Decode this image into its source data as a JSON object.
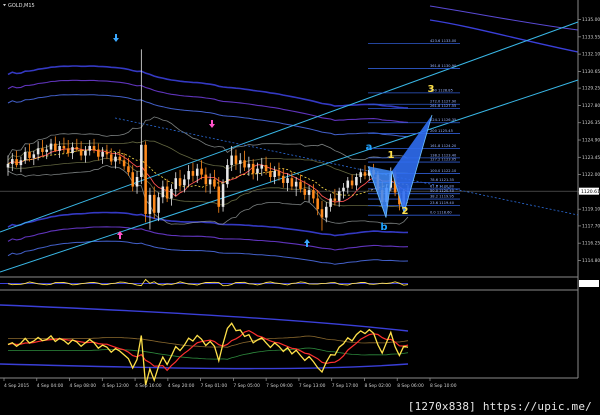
{
  "chart_data": {
    "type": "candlestick",
    "title": "GOLD,M15",
    "xlabel": "",
    "ylabel": "",
    "ylim": [
      1113.5,
      1135.8
    ],
    "grid": false,
    "legend": "none",
    "x_ticks": [
      "4 Sep 2015",
      "4 Sep 04:00",
      "4 Sep 08:00",
      "4 Sep 12:00",
      "4 Sep 16:00",
      "4 Sep 20:00",
      "7 Sep 01:00",
      "7 Sep 05:00",
      "7 Sep 09:00",
      "7 Sep 13:00",
      "7 Sep 17:00",
      "8 Sep 02:00",
      "8 Sep 06:00",
      "8 Sep 10:00"
    ],
    "y_ticks": [
      1135.0,
      1133.55,
      1132.1,
      1130.65,
      1129.25,
      1127.8,
      1126.35,
      1124.9,
      1123.45,
      1122.0,
      1120.55,
      1119.1,
      1117.7,
      1116.25,
      1114.8
    ],
    "current_price_label": "1120.61",
    "fib_levels": [
      {
        "label": "423.6 1133.00",
        "price": 1133.0
      },
      {
        "label": "361.8 1130.90",
        "price": 1130.9
      },
      {
        "label": "300 1128.85",
        "price": 1128.85
      },
      {
        "label": "272.0 1127.90",
        "price": 1127.9
      },
      {
        "label": "261.8 1127.55",
        "price": 1127.55
      },
      {
        "label": "224.1 1126.35",
        "price": 1126.35
      },
      {
        "label": "200 1125.45",
        "price": 1125.45
      },
      {
        "label": "161.8 1124.20",
        "price": 1124.2
      },
      {
        "label": "138.2 1123.40",
        "price": 1123.4
      },
      {
        "label": "127.2 1123.05",
        "price": 1123.05
      },
      {
        "label": "100.0 1122.10",
        "price": 1122.1
      },
      {
        "label": "78.6 1121.35",
        "price": 1121.35
      },
      {
        "label": "61.8 1120.80",
        "price": 1120.8
      },
      {
        "label": "50.0 1120.40",
        "price": 1120.4
      },
      {
        "label": "38.2 1119.95",
        "price": 1119.95
      },
      {
        "label": "23.6 1119.40",
        "price": 1119.4
      },
      {
        "label": "0.0 1118.60",
        "price": 1118.6
      }
    ],
    "wave_labels": [
      {
        "text": "a",
        "color": "#1fa3ff"
      },
      {
        "text": "b",
        "color": "#1fa3ff"
      },
      {
        "text": "1",
        "color": "#ffe14a"
      },
      {
        "text": "2",
        "color": "#ffe14a"
      },
      {
        "text": "3",
        "color": "#ffe14a"
      }
    ],
    "candles": [
      {
        "o": 1122.6,
        "h": 1123.6,
        "l": 1121.9,
        "c": 1122.9
      },
      {
        "o": 1122.9,
        "h": 1123.8,
        "l": 1122.3,
        "c": 1123.3
      },
      {
        "o": 1123.3,
        "h": 1124.0,
        "l": 1122.6,
        "c": 1122.8
      },
      {
        "o": 1122.8,
        "h": 1123.5,
        "l": 1122.2,
        "c": 1123.2
      },
      {
        "o": 1123.2,
        "h": 1124.3,
        "l": 1122.9,
        "c": 1123.9
      },
      {
        "o": 1123.9,
        "h": 1124.6,
        "l": 1123.1,
        "c": 1123.4
      },
      {
        "o": 1123.4,
        "h": 1124.0,
        "l": 1122.8,
        "c": 1123.7
      },
      {
        "o": 1123.7,
        "h": 1124.8,
        "l": 1123.2,
        "c": 1124.2
      },
      {
        "o": 1124.2,
        "h": 1124.9,
        "l": 1123.6,
        "c": 1123.9
      },
      {
        "o": 1123.9,
        "h": 1124.5,
        "l": 1123.3,
        "c": 1124.1
      },
      {
        "o": 1124.1,
        "h": 1125.0,
        "l": 1123.7,
        "c": 1124.6
      },
      {
        "o": 1124.6,
        "h": 1125.2,
        "l": 1123.9,
        "c": 1124.0
      },
      {
        "o": 1124.0,
        "h": 1124.8,
        "l": 1123.4,
        "c": 1124.4
      },
      {
        "o": 1124.4,
        "h": 1125.1,
        "l": 1123.8,
        "c": 1124.2
      },
      {
        "o": 1124.2,
        "h": 1124.9,
        "l": 1123.5,
        "c": 1123.8
      },
      {
        "o": 1123.8,
        "h": 1124.7,
        "l": 1123.3,
        "c": 1124.3
      },
      {
        "o": 1124.3,
        "h": 1125.0,
        "l": 1123.9,
        "c": 1124.1
      },
      {
        "o": 1124.1,
        "h": 1124.8,
        "l": 1123.2,
        "c": 1123.6
      },
      {
        "o": 1123.6,
        "h": 1124.4,
        "l": 1123.0,
        "c": 1124.0
      },
      {
        "o": 1124.0,
        "h": 1124.9,
        "l": 1123.6,
        "c": 1124.4
      },
      {
        "o": 1124.4,
        "h": 1125.0,
        "l": 1123.8,
        "c": 1124.1
      },
      {
        "o": 1124.1,
        "h": 1124.6,
        "l": 1123.2,
        "c": 1123.5
      },
      {
        "o": 1123.5,
        "h": 1124.3,
        "l": 1122.9,
        "c": 1123.9
      },
      {
        "o": 1123.9,
        "h": 1124.5,
        "l": 1123.3,
        "c": 1123.7
      },
      {
        "o": 1123.7,
        "h": 1124.2,
        "l": 1122.8,
        "c": 1123.1
      },
      {
        "o": 1123.1,
        "h": 1123.9,
        "l": 1122.5,
        "c": 1123.5
      },
      {
        "o": 1123.5,
        "h": 1124.1,
        "l": 1122.9,
        "c": 1123.2
      },
      {
        "o": 1123.2,
        "h": 1123.8,
        "l": 1122.4,
        "c": 1122.7
      },
      {
        "o": 1122.7,
        "h": 1123.4,
        "l": 1121.9,
        "c": 1122.2
      },
      {
        "o": 1122.2,
        "h": 1122.8,
        "l": 1120.6,
        "c": 1121.0
      },
      {
        "o": 1121.0,
        "h": 1122.3,
        "l": 1120.4,
        "c": 1121.8
      },
      {
        "o": 1121.8,
        "h": 1132.5,
        "l": 1121.2,
        "c": 1124.5
      },
      {
        "o": 1124.5,
        "h": 1124.8,
        "l": 1118.0,
        "c": 1118.7
      },
      {
        "o": 1118.7,
        "h": 1120.9,
        "l": 1117.4,
        "c": 1120.3
      },
      {
        "o": 1120.3,
        "h": 1121.0,
        "l": 1118.3,
        "c": 1118.8
      },
      {
        "o": 1118.8,
        "h": 1120.5,
        "l": 1118.1,
        "c": 1120.1
      },
      {
        "o": 1120.1,
        "h": 1121.5,
        "l": 1119.6,
        "c": 1121.0
      },
      {
        "o": 1121.0,
        "h": 1121.6,
        "l": 1119.7,
        "c": 1120.0
      },
      {
        "o": 1120.0,
        "h": 1121.2,
        "l": 1119.4,
        "c": 1120.8
      },
      {
        "o": 1120.8,
        "h": 1122.2,
        "l": 1120.2,
        "c": 1121.7
      },
      {
        "o": 1121.7,
        "h": 1122.4,
        "l": 1120.6,
        "c": 1121.1
      },
      {
        "o": 1121.1,
        "h": 1122.0,
        "l": 1120.5,
        "c": 1121.6
      },
      {
        "o": 1121.6,
        "h": 1122.8,
        "l": 1121.0,
        "c": 1122.3
      },
      {
        "o": 1122.3,
        "h": 1123.0,
        "l": 1121.4,
        "c": 1121.9
      },
      {
        "o": 1121.9,
        "h": 1122.9,
        "l": 1121.3,
        "c": 1122.5
      },
      {
        "o": 1122.5,
        "h": 1123.2,
        "l": 1121.6,
        "c": 1122.0
      },
      {
        "o": 1122.0,
        "h": 1122.6,
        "l": 1120.5,
        "c": 1121.2
      },
      {
        "o": 1121.2,
        "h": 1122.1,
        "l": 1120.4,
        "c": 1121.6
      },
      {
        "o": 1121.6,
        "h": 1122.4,
        "l": 1120.8,
        "c": 1121.0
      },
      {
        "o": 1121.0,
        "h": 1121.8,
        "l": 1118.8,
        "c": 1119.3
      },
      {
        "o": 1119.3,
        "h": 1121.6,
        "l": 1118.9,
        "c": 1121.2
      },
      {
        "o": 1121.2,
        "h": 1123.3,
        "l": 1120.9,
        "c": 1122.8
      },
      {
        "o": 1122.8,
        "h": 1124.4,
        "l": 1122.3,
        "c": 1123.6
      },
      {
        "o": 1123.6,
        "h": 1124.1,
        "l": 1122.4,
        "c": 1122.9
      },
      {
        "o": 1122.9,
        "h": 1123.8,
        "l": 1122.1,
        "c": 1123.2
      },
      {
        "o": 1123.2,
        "h": 1124.0,
        "l": 1122.3,
        "c": 1122.6
      },
      {
        "o": 1122.6,
        "h": 1123.5,
        "l": 1121.9,
        "c": 1122.9
      },
      {
        "o": 1122.9,
        "h": 1123.3,
        "l": 1121.6,
        "c": 1122.1
      },
      {
        "o": 1122.1,
        "h": 1123.0,
        "l": 1121.5,
        "c": 1122.5
      },
      {
        "o": 1122.5,
        "h": 1123.4,
        "l": 1121.9,
        "c": 1122.8
      },
      {
        "o": 1122.8,
        "h": 1123.5,
        "l": 1122.0,
        "c": 1122.3
      },
      {
        "o": 1122.3,
        "h": 1123.0,
        "l": 1121.4,
        "c": 1121.8
      },
      {
        "o": 1121.8,
        "h": 1122.7,
        "l": 1121.2,
        "c": 1122.3
      },
      {
        "o": 1122.3,
        "h": 1123.0,
        "l": 1121.5,
        "c": 1121.9
      },
      {
        "o": 1121.9,
        "h": 1122.5,
        "l": 1120.9,
        "c": 1121.3
      },
      {
        "o": 1121.3,
        "h": 1122.1,
        "l": 1120.6,
        "c": 1121.7
      },
      {
        "o": 1121.7,
        "h": 1122.2,
        "l": 1120.7,
        "c": 1121.0
      },
      {
        "o": 1121.0,
        "h": 1121.8,
        "l": 1120.2,
        "c": 1121.4
      },
      {
        "o": 1121.4,
        "h": 1122.0,
        "l": 1120.5,
        "c": 1120.8
      },
      {
        "o": 1120.8,
        "h": 1121.5,
        "l": 1119.9,
        "c": 1120.3
      },
      {
        "o": 1120.3,
        "h": 1121.1,
        "l": 1119.7,
        "c": 1120.7
      },
      {
        "o": 1120.7,
        "h": 1121.2,
        "l": 1119.6,
        "c": 1120.0
      },
      {
        "o": 1120.0,
        "h": 1120.7,
        "l": 1118.6,
        "c": 1119.1
      },
      {
        "o": 1119.1,
        "h": 1119.8,
        "l": 1117.3,
        "c": 1118.4
      },
      {
        "o": 1118.4,
        "h": 1119.7,
        "l": 1118.0,
        "c": 1119.3
      },
      {
        "o": 1119.3,
        "h": 1120.4,
        "l": 1118.9,
        "c": 1120.0
      },
      {
        "o": 1120.0,
        "h": 1120.8,
        "l": 1119.4,
        "c": 1119.8
      },
      {
        "o": 1119.8,
        "h": 1120.9,
        "l": 1119.3,
        "c": 1120.6
      },
      {
        "o": 1120.6,
        "h": 1121.3,
        "l": 1120.0,
        "c": 1120.9
      },
      {
        "o": 1120.9,
        "h": 1121.8,
        "l": 1120.4,
        "c": 1121.5
      },
      {
        "o": 1121.5,
        "h": 1122.0,
        "l": 1120.8,
        "c": 1121.1
      },
      {
        "o": 1121.1,
        "h": 1122.1,
        "l": 1120.7,
        "c": 1121.8
      },
      {
        "o": 1121.8,
        "h": 1122.5,
        "l": 1121.3,
        "c": 1122.2
      },
      {
        "o": 1122.2,
        "h": 1122.8,
        "l": 1121.6,
        "c": 1121.9
      },
      {
        "o": 1121.9,
        "h": 1122.7,
        "l": 1121.5,
        "c": 1122.4
      },
      {
        "o": 1122.4,
        "h": 1122.9,
        "l": 1121.7,
        "c": 1122.0
      },
      {
        "o": 1122.0,
        "h": 1122.3,
        "l": 1120.3,
        "c": 1120.7
      },
      {
        "o": 1120.7,
        "h": 1121.4,
        "l": 1119.3,
        "c": 1119.7
      },
      {
        "o": 1119.7,
        "h": 1121.2,
        "l": 1119.4,
        "c": 1120.9
      },
      {
        "o": 1120.9,
        "h": 1122.6,
        "l": 1120.6,
        "c": 1122.1
      },
      {
        "o": 1122.1,
        "h": 1122.4,
        "l": 1120.2,
        "c": 1120.5
      },
      {
        "o": 1120.5,
        "h": 1120.9,
        "l": 1119.0,
        "c": 1119.5
      },
      {
        "o": 1119.5,
        "h": 1120.8,
        "l": 1119.2,
        "c": 1120.6
      },
      {
        "o": 1120.6,
        "h": 1121.1,
        "l": 1120.1,
        "c": 1120.61
      }
    ]
  },
  "watermark": "[1270x838] https://upic.me/"
}
